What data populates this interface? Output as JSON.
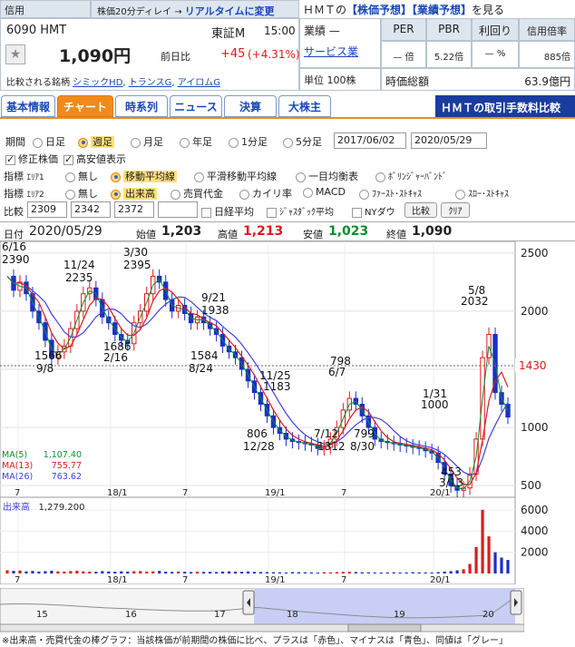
{
  "header": {
    "credit_label": "信用",
    "delay_text": "株価20分ディレイ →",
    "realtime_link": "リアルタイムに変更",
    "forecast_prefix": "ＨＭＴの",
    "forecast_stock": "【株価予想】",
    "forecast_perf": "【業績予想】",
    "forecast_suffix": "を見る"
  },
  "stock": {
    "code_name": "6090 HMT",
    "market": "東証M",
    "time": "15:00",
    "price": "1,090円",
    "change_label": "前日比",
    "change": "+45",
    "change_pct": "(+4.31%)",
    "compare_label": "比較される銘柄",
    "compare_links": [
      "シミックHD",
      "トランスG",
      "アイロムG"
    ]
  },
  "info": {
    "industry_label": "業績",
    "industry_dash": "—",
    "industry_link": "サービス業",
    "unit_label": "単位",
    "unit_value": "100株",
    "per_label": "PER",
    "pbr_label": "PBR",
    "yield_label": "利回り",
    "margin_label": "信用倍率",
    "per_value": "— 倍",
    "pbr_value": "5.22倍",
    "yield_value": "— %",
    "margin_value": "885倍",
    "mcap_label": "時価総額",
    "mcap_value": "63.9億円"
  },
  "tabs": [
    "基本情報",
    "チャート",
    "時系列",
    "ニュース",
    "決算",
    "大株主"
  ],
  "fee_banner": "ＨＭＴの取引手数料比較",
  "controls": {
    "period_label": "期間",
    "periods": [
      "日足",
      "週足",
      "月足",
      "年足",
      "1分足",
      "5分足"
    ],
    "date_from": "2017/06/02",
    "date_to": "2020/05/29",
    "adjusted_label": "修正株価",
    "highlow_label": "高安値表示",
    "indicator1_label": "指標",
    "area1": "ｴﾘｱ1",
    "area1_opts": [
      "無し",
      "移動平均線",
      "平滑移動平均線",
      "一目均衡表",
      "ﾎﾞﾘﾝｼﾞｬｰﾊﾞﾝﾄﾞ"
    ],
    "area2": "ｴﾘｱ2",
    "area2_opts": [
      "無し",
      "出来高",
      "売買代金",
      "カイリ率",
      "MACD",
      "ﾌｧｰｽﾄ･ｽﾄｷｬｽ",
      "ｽﾛｰ･ｽﾄｷｬｽ"
    ],
    "compare_label": "比較",
    "compare_values": [
      "2309",
      "2342",
      "2372",
      ""
    ],
    "nikkei_label": "日経平均",
    "jasdaq_label": "ｼﾞｬｽﾀﾞｯｸ平均",
    "nydow_label": "NYダウ",
    "compare_btn": "比較",
    "clear_btn": "ｸﾘｱ"
  },
  "ohlc": {
    "date_label": "日付",
    "date": "2020/05/29",
    "open_label": "始値",
    "open": "1,203",
    "high_label": "高値",
    "high": "1,213",
    "low_label": "安値",
    "low": "1,023",
    "close_label": "終値",
    "close": "1,090"
  },
  "ma": {
    "ma5_label": "MA(5)",
    "ma5": "1,107.40",
    "ma13_label": "MA(13)",
    "ma13": "755.77",
    "ma26_label": "MA(26)",
    "ma26": "763.62"
  },
  "volume_panel": {
    "label": "出来高",
    "value": "1,279.200",
    "y_ticks": [
      "6000",
      "4000",
      "2000"
    ]
  },
  "colors": {
    "up": "#e0191b",
    "down": "#1a2fc8",
    "ma5": "#0a8f2f",
    "ma13": "#e0191b",
    "ma26": "#4040e0",
    "accent": "#f08a1a"
  },
  "chart_data": {
    "type": "candlestick",
    "price_axis": {
      "ticks": [
        500,
        1000,
        1500,
        2000,
        2500
      ],
      "ylim": [
        400,
        2600
      ],
      "current_marker": "1430"
    },
    "x_ticks": [
      "7",
      "18/1",
      "7",
      "19/1",
      "7",
      "20/1"
    ],
    "annotations": [
      {
        "text": "6/16",
        "value": 2390
      },
      {
        "text": "2390"
      },
      {
        "text": "11/24"
      },
      {
        "text": "2235",
        "value": 2235
      },
      {
        "text": "3/30"
      },
      {
        "text": "2395",
        "value": 2395
      },
      {
        "text": "1566",
        "value": 1566
      },
      {
        "text": "9/8"
      },
      {
        "text": "1686",
        "value": 1686
      },
      {
        "text": "2/16"
      },
      {
        "text": "9/21"
      },
      {
        "text": "1938",
        "value": 1938
      },
      {
        "text": "1584",
        "value": 1584
      },
      {
        "text": "8/24"
      },
      {
        "text": "11/25"
      },
      {
        "text": "1183",
        "value": 1183
      },
      {
        "text": "806",
        "value": 806
      },
      {
        "text": "12/28"
      },
      {
        "text": "7/12"
      },
      {
        "text": "1312",
        "value": 1312
      },
      {
        "text": "798",
        "value": 798
      },
      {
        "text": "6/7"
      },
      {
        "text": "799",
        "value": 799
      },
      {
        "text": "8/30"
      },
      {
        "text": "1/31"
      },
      {
        "text": "1000",
        "value": 1000
      },
      {
        "text": "453",
        "value": 453
      },
      {
        "text": "3/13"
      },
      {
        "text": "5/8"
      },
      {
        "text": "2032",
        "value": 2032
      }
    ],
    "close_series": [
      2300,
      2180,
      2250,
      2150,
      2000,
      1900,
      1750,
      1600,
      1650,
      1700,
      1850,
      2000,
      2150,
      2200,
      2100,
      1950,
      1900,
      1800,
      1750,
      1720,
      1900,
      2000,
      2150,
      2300,
      2250,
      2100,
      2000,
      2050,
      1980,
      1900,
      1950,
      1900,
      1850,
      1800,
      1700,
      1650,
      1600,
      1500,
      1400,
      1300,
      1200,
      1100,
      1000,
      950,
      900,
      880,
      870,
      860,
      850,
      820,
      830,
      900,
      1000,
      1150,
      1250,
      1200,
      1100,
      1000,
      900,
      880,
      870,
      860,
      850,
      840,
      830,
      820,
      800,
      780,
      700,
      600,
      500,
      460,
      480,
      600,
      900,
      1600,
      1800,
      1300,
      1200,
      1090
    ],
    "volume_series": [
      300,
      250,
      280,
      200,
      240,
      180,
      220,
      260,
      200,
      180,
      230,
      250,
      200,
      180,
      160,
      220,
      190,
      170,
      200,
      180,
      210,
      230,
      180,
      200,
      240,
      170,
      150,
      180,
      160,
      140,
      170,
      150,
      160,
      140,
      180,
      200,
      170,
      160,
      190,
      150,
      140,
      130,
      120,
      110,
      100,
      130,
      120,
      110,
      100,
      90,
      120,
      100,
      130,
      150,
      160,
      140,
      120,
      110,
      100,
      90,
      100,
      110,
      90,
      100,
      120,
      110,
      100,
      90,
      130,
      180,
      220,
      300,
      400,
      900,
      2500,
      6000,
      3500,
      2000,
      1500,
      1279
    ]
  },
  "footer_note": "※出来高・売買代金の棒グラフ：当該株価が前期間の株価に比べ、プラスは「赤色」、マイナスは「青色」、同値は「グレー」",
  "nav": {
    "ticks": [
      "15",
      "16",
      "17",
      "18",
      "19",
      "20"
    ]
  }
}
